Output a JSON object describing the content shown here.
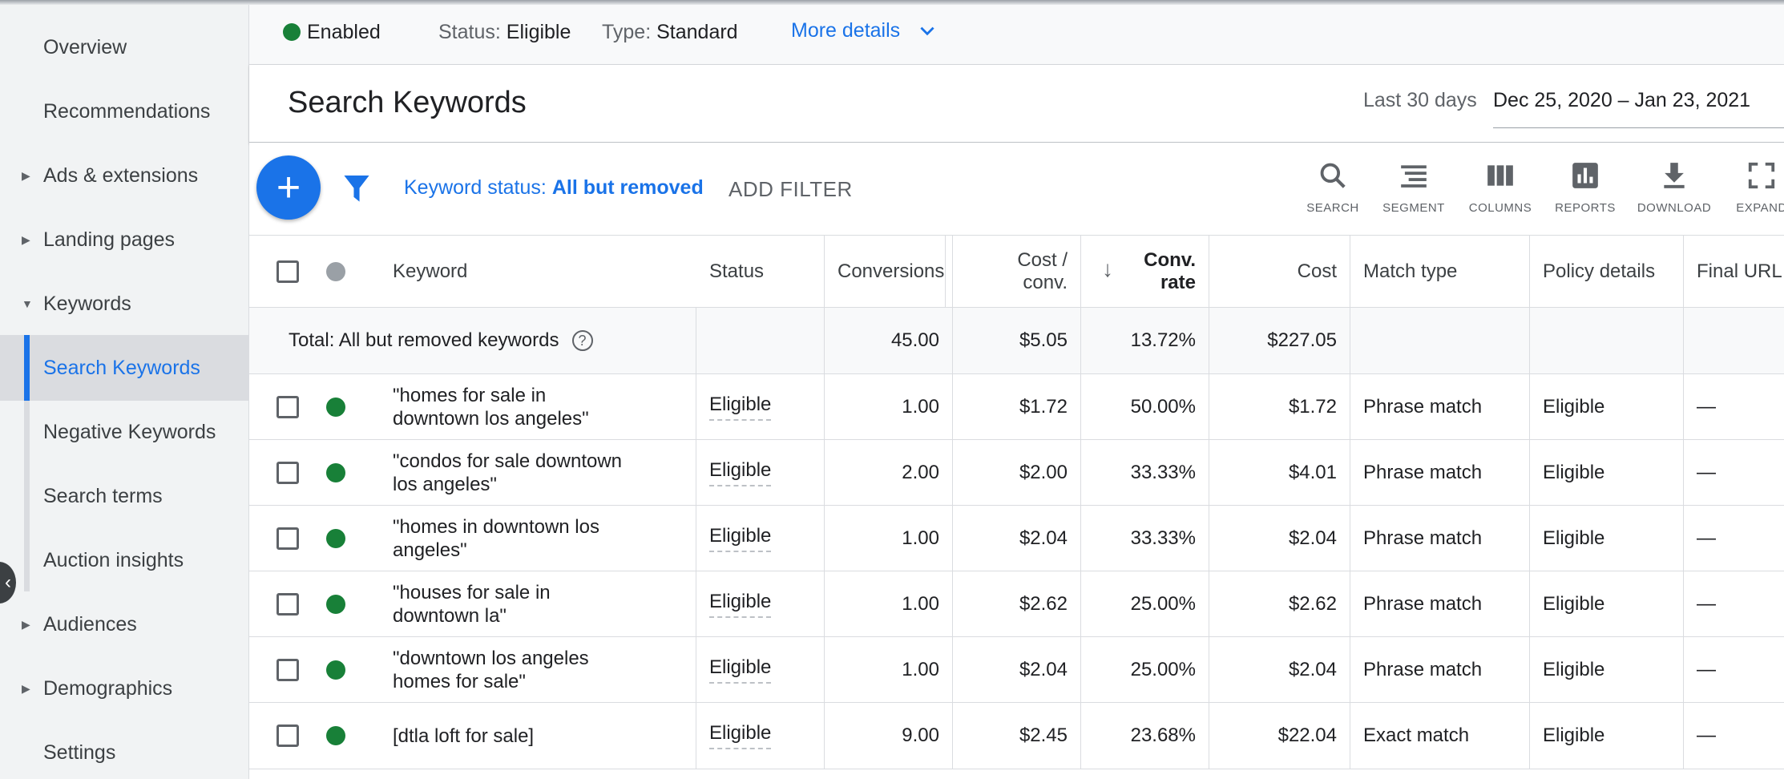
{
  "sidebar": {
    "items": [
      {
        "label": "Overview",
        "caret": ""
      },
      {
        "label": "Recommendations",
        "caret": ""
      },
      {
        "label": "Ads & extensions",
        "caret": "▶"
      },
      {
        "label": "Landing pages",
        "caret": "▶"
      },
      {
        "label": "Keywords",
        "caret": "▼"
      },
      {
        "label": "Search Keywords",
        "caret": ""
      },
      {
        "label": "Negative Keywords",
        "caret": ""
      },
      {
        "label": "Search terms",
        "caret": ""
      },
      {
        "label": "Auction insights",
        "caret": ""
      },
      {
        "label": "Audiences",
        "caret": "▶"
      },
      {
        "label": "Demographics",
        "caret": "▶"
      },
      {
        "label": "Settings",
        "caret": ""
      }
    ],
    "active_item": "Search Keywords"
  },
  "status_bar": {
    "enabled_label": "Enabled",
    "status_key": "Status:",
    "status_value": "Eligible",
    "type_key": "Type:",
    "type_value": "Standard",
    "more_details": "More details"
  },
  "header": {
    "title": "Search Keywords",
    "date_label": "Last 30 days",
    "date_range": "Dec 25, 2020 – Jan 23, 2021"
  },
  "toolbar": {
    "add_button": "+",
    "filter_key": "Keyword status:",
    "filter_value": "All but removed",
    "add_filter": "ADD FILTER",
    "tools": [
      {
        "label": "SEARCH",
        "icon": "search-icon"
      },
      {
        "label": "SEGMENT",
        "icon": "segment-icon"
      },
      {
        "label": "COLUMNS",
        "icon": "columns-icon"
      },
      {
        "label": "REPORTS",
        "icon": "reports-icon"
      },
      {
        "label": "DOWNLOAD",
        "icon": "download-icon"
      },
      {
        "label": "EXPAND",
        "icon": "expand-icon"
      }
    ]
  },
  "table": {
    "columns": {
      "keyword": "Keyword",
      "status": "Status",
      "conversions": "Conversions",
      "cost_conv_1": "Cost /",
      "cost_conv_2": "conv.",
      "conv_rate_1": "Conv.",
      "conv_rate_2": "rate",
      "cost": "Cost",
      "match_type": "Match type",
      "policy_details": "Policy details",
      "final_url": "Final URL"
    },
    "sort_arrow": "↓",
    "total": {
      "label": "Total: All but removed keywords",
      "help": "?",
      "conversions": "45.00",
      "cost_conv": "$5.05",
      "conv_rate": "13.72%",
      "cost": "$227.05"
    },
    "rows": [
      {
        "keyword_1": "\"homes for sale in",
        "keyword_2": "downtown los angeles\"",
        "status": "Eligible",
        "conversions": "1.00",
        "cost_conv": "$1.72",
        "conv_rate": "50.00%",
        "cost": "$1.72",
        "match_type": "Phrase match",
        "policy": "Eligible",
        "final_url": "—"
      },
      {
        "keyword_1": "\"condos for sale downtown",
        "keyword_2": "los angeles\"",
        "status": "Eligible",
        "conversions": "2.00",
        "cost_conv": "$2.00",
        "conv_rate": "33.33%",
        "cost": "$4.01",
        "match_type": "Phrase match",
        "policy": "Eligible",
        "final_url": "—"
      },
      {
        "keyword_1": "\"homes in downtown los",
        "keyword_2": "angeles\"",
        "status": "Eligible",
        "conversions": "1.00",
        "cost_conv": "$2.04",
        "conv_rate": "33.33%",
        "cost": "$2.04",
        "match_type": "Phrase match",
        "policy": "Eligible",
        "final_url": "—"
      },
      {
        "keyword_1": "\"houses for sale in",
        "keyword_2": "downtown la\"",
        "status": "Eligible",
        "conversions": "1.00",
        "cost_conv": "$2.62",
        "conv_rate": "25.00%",
        "cost": "$2.62",
        "match_type": "Phrase match",
        "policy": "Eligible",
        "final_url": "—"
      },
      {
        "keyword_1": "\"downtown los angeles",
        "keyword_2": "homes for sale\"",
        "status": "Eligible",
        "conversions": "1.00",
        "cost_conv": "$2.04",
        "conv_rate": "25.00%",
        "cost": "$2.04",
        "match_type": "Phrase match",
        "policy": "Eligible",
        "final_url": "—"
      },
      {
        "keyword_1": "[dtla loft for sale]",
        "keyword_2": "",
        "status": "Eligible",
        "conversions": "9.00",
        "cost_conv": "$2.45",
        "conv_rate": "23.68%",
        "cost": "$22.04",
        "match_type": "Exact match",
        "policy": "Eligible",
        "final_url": "—"
      }
    ]
  },
  "colors": {
    "accent": "#1a73e8",
    "enabled_green": "#188038",
    "sidebar_bg": "#f1f3f4"
  }
}
